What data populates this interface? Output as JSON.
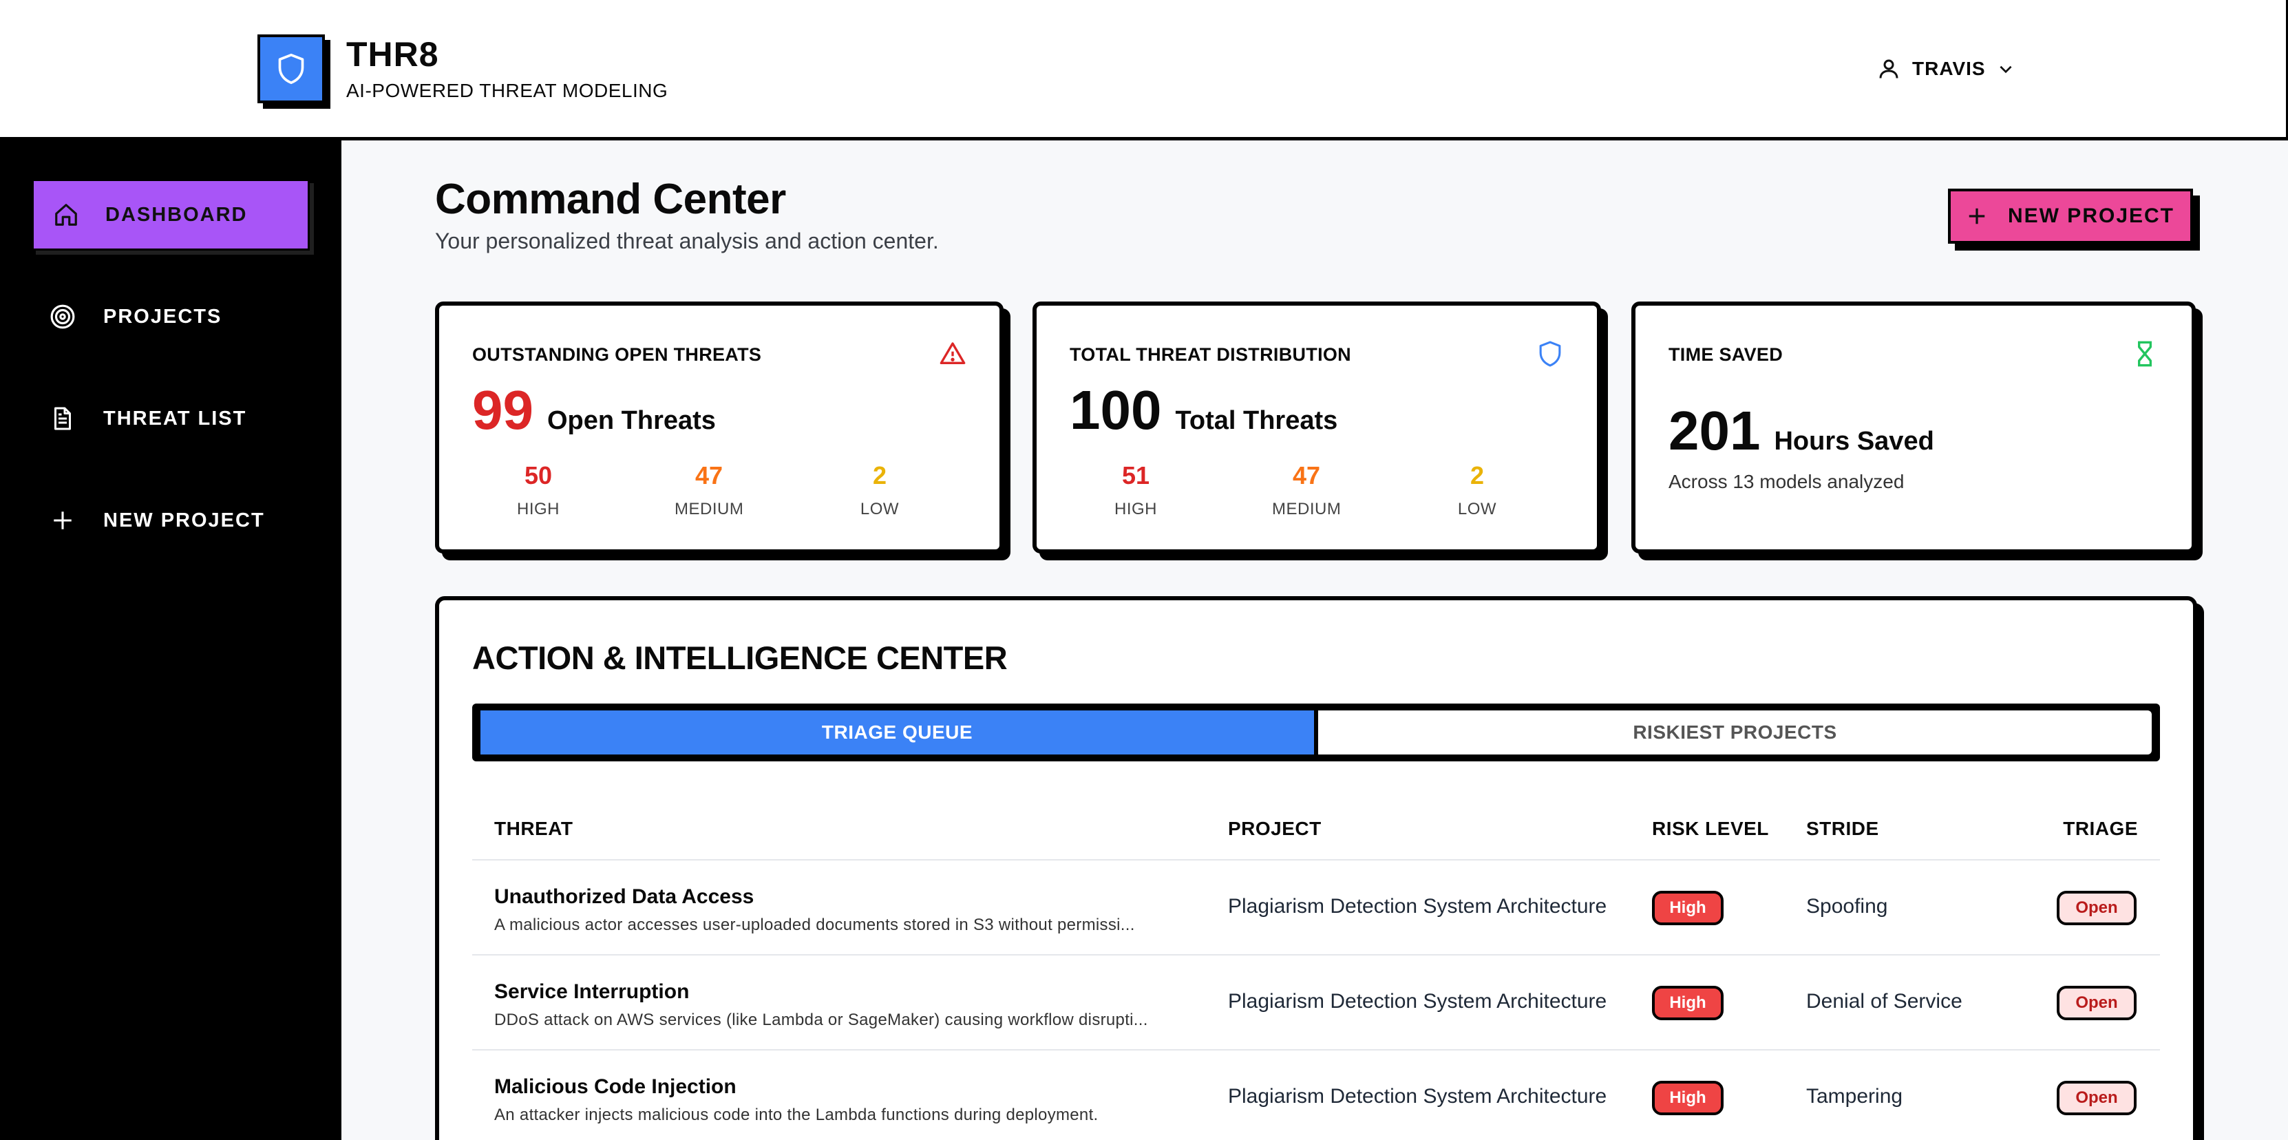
{
  "header": {
    "brand_title": "THR8",
    "brand_subtitle": "AI-POWERED THREAT MODELING",
    "user_name": "TRAVIS"
  },
  "sidebar": {
    "items": [
      {
        "label": "DASHBOARD",
        "icon": "home-icon",
        "active": true
      },
      {
        "label": "PROJECTS",
        "icon": "target-icon",
        "active": false
      },
      {
        "label": "THREAT LIST",
        "icon": "document-icon",
        "active": false
      },
      {
        "label": "NEW PROJECT",
        "icon": "plus-icon",
        "active": false
      }
    ]
  },
  "main": {
    "title": "Command Center",
    "subtitle": "Your personalized threat analysis and action center.",
    "new_project_label": "NEW PROJECT"
  },
  "cards": {
    "open_threats": {
      "label": "OUTSTANDING OPEN THREATS",
      "icon": "warning-icon",
      "value": "99",
      "value_label": "Open Threats",
      "high": "50",
      "high_label": "HIGH",
      "medium": "47",
      "medium_label": "MEDIUM",
      "low": "2",
      "low_label": "LOW"
    },
    "distribution": {
      "label": "TOTAL THREAT DISTRIBUTION",
      "icon": "shield-icon",
      "value": "100",
      "value_label": "Total Threats",
      "high": "51",
      "high_label": "HIGH",
      "medium": "47",
      "medium_label": "MEDIUM",
      "low": "2",
      "low_label": "LOW"
    },
    "time_saved": {
      "label": "TIME SAVED",
      "icon": "hourglass-icon",
      "value": "201",
      "value_label": "Hours Saved",
      "sub": "Across 13 models analyzed"
    }
  },
  "action_center": {
    "title": "ACTION & INTELLIGENCE CENTER",
    "tabs": [
      {
        "label": "TRIAGE QUEUE",
        "active": true
      },
      {
        "label": "RISKIEST PROJECTS",
        "active": false
      }
    ],
    "columns": {
      "threat": "THREAT",
      "project": "PROJECT",
      "risk": "RISK LEVEL",
      "stride": "STRIDE",
      "triage": "TRIAGE"
    },
    "rows": [
      {
        "name": "Unauthorized Data Access",
        "desc": "A malicious actor accesses user-uploaded documents stored in S3 without permissi...",
        "project": "Plagiarism Detection System Architecture",
        "risk": "High",
        "stride": "Spoofing",
        "triage": "Open"
      },
      {
        "name": "Service Interruption",
        "desc": "DDoS attack on AWS services (like Lambda or SageMaker) causing workflow disrupti...",
        "project": "Plagiarism Detection System Architecture",
        "risk": "High",
        "stride": "Denial of Service",
        "triage": "Open"
      },
      {
        "name": "Malicious Code Injection",
        "desc": "An attacker injects malicious code into the Lambda functions during deployment.",
        "project": "Plagiarism Detection System Architecture",
        "risk": "High",
        "stride": "Tampering",
        "triage": "Open"
      }
    ]
  },
  "colors": {
    "accent_purple": "#a855f7",
    "accent_pink": "#ec4899",
    "accent_blue": "#3b82f6",
    "high_red": "#dc2626",
    "medium_orange": "#f97316",
    "low_amber": "#eab308",
    "time_green": "#22c55e"
  }
}
